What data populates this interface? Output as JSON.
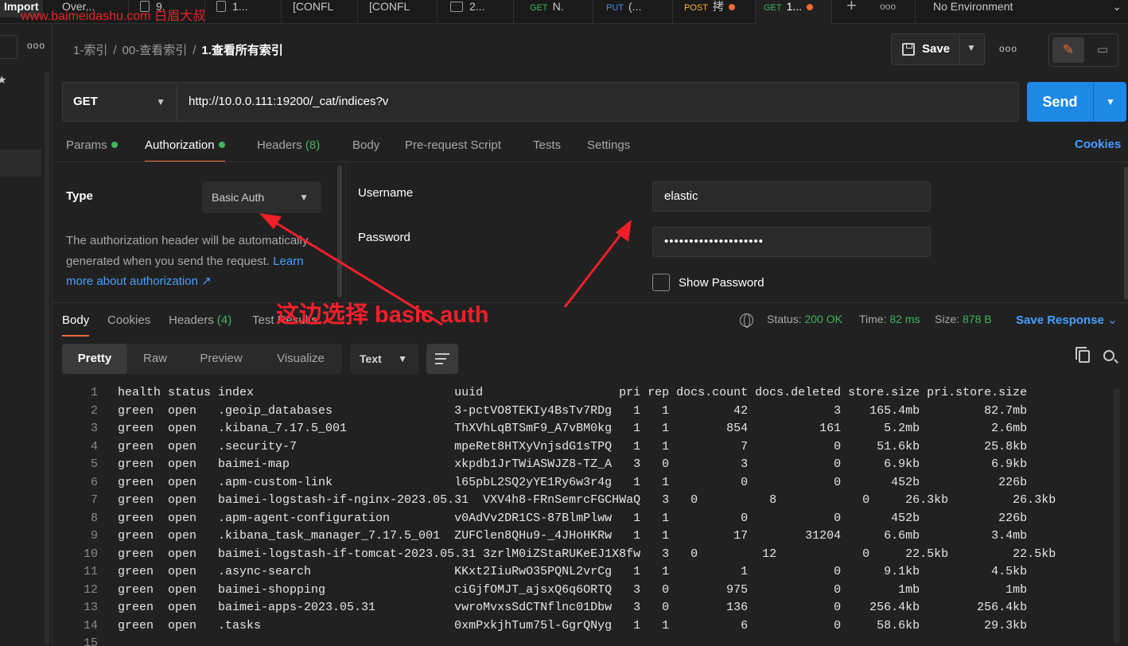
{
  "topbar": {
    "import_label": "Import",
    "watermark": "www.baimeidashu.com 白眉大叔",
    "tabs": [
      {
        "method": "",
        "label": "Over...",
        "dot": false
      },
      {
        "method": "",
        "label": "9.",
        "dot": false
      },
      {
        "method": "",
        "label": "1...",
        "dot": false
      },
      {
        "method": "",
        "label": "[CONFL",
        "dot": false
      },
      {
        "method": "",
        "label": "[CONFL",
        "dot": false
      },
      {
        "method": "",
        "label": "2...",
        "dot": false
      },
      {
        "method": "GET",
        "label": "N.",
        "dot": false
      },
      {
        "method": "PUT",
        "label": "(...",
        "dot": false
      },
      {
        "method": "POST",
        "label": "拷",
        "dot": true
      },
      {
        "method": "GET",
        "label": "1...",
        "dot": true
      }
    ],
    "new_tab": "+",
    "more": "ooo",
    "environment": "No Environment"
  },
  "sidebar": {
    "more": "ooo",
    "star": "★"
  },
  "breadcrumb": {
    "items": [
      "1-索引",
      "00-查看索引"
    ],
    "current": "1.查看所有索引",
    "sep": "/"
  },
  "toolbar": {
    "save_label": "Save",
    "more": "ooo",
    "edit_icon": "✎",
    "doc_icon": "▭"
  },
  "request": {
    "method": "GET",
    "url": "http://10.0.0.111:19200/_cat/indices?v",
    "send_label": "Send"
  },
  "request_tabs": [
    {
      "label": "Params",
      "dot": true,
      "count": ""
    },
    {
      "label": "Authorization",
      "dot": true,
      "count": "",
      "active": true
    },
    {
      "label": "Headers",
      "dot": false,
      "count": "(8)"
    },
    {
      "label": "Body",
      "dot": false,
      "count": ""
    },
    {
      "label": "Pre-request Script",
      "dot": false,
      "count": ""
    },
    {
      "label": "Tests",
      "dot": false,
      "count": ""
    },
    {
      "label": "Settings",
      "dot": false,
      "count": ""
    }
  ],
  "cookies_link": "Cookies",
  "auth": {
    "type_label": "Type",
    "type_value": "Basic Auth",
    "description": "The authorization header will be automatically generated when you send the request.",
    "learn_more": "Learn more about authorization ↗",
    "username_label": "Username",
    "username_value": "elastic",
    "password_label": "Password",
    "password_value": "••••••••••••••••••••",
    "show_password_label": "Show Password"
  },
  "annotation": {
    "text": "这边选择  basic auth",
    "color": "#f0202a"
  },
  "response": {
    "tabs": [
      {
        "label": "Body",
        "count": "",
        "active": true
      },
      {
        "label": "Cookies",
        "count": ""
      },
      {
        "label": "Headers",
        "count": "(4)"
      },
      {
        "label": "Test Results",
        "count": ""
      }
    ],
    "status_label": "Status:",
    "status_value": "200 OK",
    "time_label": "Time:",
    "time_value": "82 ms",
    "size_label": "Size:",
    "size_value": "878 B",
    "save_response": "Save Response",
    "formats": [
      "Pretty",
      "Raw",
      "Preview",
      "Visualize"
    ],
    "active_format": "Pretty",
    "text_type": "Text"
  },
  "code_lines": [
    "health status index                            uuid                   pri rep docs.count docs.deleted store.size pri.store.size",
    "green  open   .geoip_databases                 3-pctVO8TEKIy4BsTv7RDg   1   1         42            3    165.4mb         82.7mb",
    "green  open   .kibana_7.17.5_001               ThXVhLqBTSmF9_A7vBM0kg   1   1        854          161      5.2mb          2.6mb",
    "green  open   .security-7                      mpeRet8HTXyVnjsdG1sTPQ   1   1          7            0     51.6kb         25.8kb",
    "green  open   baimei-map                       xkpdb1JrTWiASWJZ8-TZ_A   3   0          3            0      6.9kb          6.9kb",
    "green  open   .apm-custom-link                 l65pbL2SQ2yYE1Ry6w3r4g   1   1          0            0       452b           226b",
    "green  open   baimei-logstash-if-nginx-2023.05.31  VXV4h8-FRnSemrcFGCHWaQ   3   0          8            0     26.3kb         26.3kb",
    "green  open   .apm-agent-configuration         v0AdVv2DR1CS-87BlmPlww   1   1          0            0       452b           226b",
    "green  open   .kibana_task_manager_7.17.5_001  ZUFClen8QHu9-_4JHoHKRw   1   1         17        31204      6.6mb          3.4mb",
    "green  open   baimei-logstash-if-tomcat-2023.05.31 3zrlM0iZStaRUKeEJ1X8fw   3   0         12            0     22.5kb         22.5kb",
    "green  open   .async-search                    KKxt2IiuRwO35PQNL2vrCg   1   1          1            0      9.1kb          4.5kb",
    "green  open   baimei-shopping                  ciGjfOMJT_ajsxQ6q6ORTQ   3   0        975            0        1mb            1mb",
    "green  open   baimei-apps-2023.05.31           vwroMvxsSdCTNflnc01Dbw   3   0        136            0    256.4kb        256.4kb",
    "green  open   .tasks                           0xmPxkjhTum75l-GgrQNyg   1   1          6            0     58.6kb         29.3kb",
    ""
  ]
}
